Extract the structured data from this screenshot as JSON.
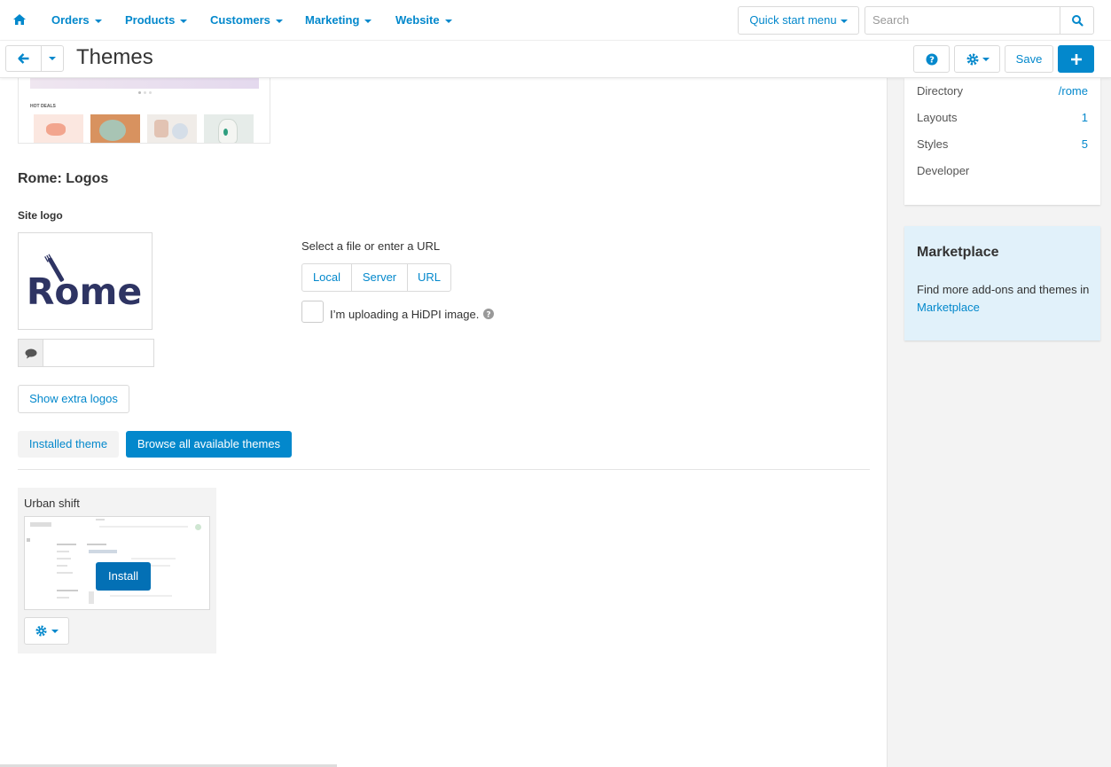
{
  "nav": {
    "items": [
      "Orders",
      "Products",
      "Customers",
      "Marketing",
      "Website"
    ],
    "quick_start": "Quick start menu",
    "search_placeholder": "Search"
  },
  "header": {
    "title": "Themes",
    "save_label": "Save"
  },
  "logos": {
    "section_title": "Rome: Logos",
    "site_logo_label": "Site logo",
    "logo_text": "Rome",
    "select_label": "Select a file or enter a URL",
    "source_options": [
      "Local",
      "Server",
      "URL"
    ],
    "hidpi_label": "I’m uploading a HiDPI image.",
    "hidpi_checked": false,
    "extra_logos_label": "Show extra logos"
  },
  "preview_top": {
    "caption": "HOT DEALS"
  },
  "tabs": {
    "installed": "Installed theme",
    "browse": "Browse all available themes"
  },
  "available_themes": [
    {
      "name": "Urban shift",
      "install_label": "Install"
    }
  ],
  "sidebar": {
    "info": [
      {
        "key": "Directory",
        "value": "/rome"
      },
      {
        "key": "Layouts",
        "value": "1"
      },
      {
        "key": "Styles",
        "value": "5"
      },
      {
        "key": "Developer",
        "value": ""
      }
    ],
    "marketplace": {
      "title": "Marketplace",
      "text": "Find more add-ons and themes in ",
      "link": "Marketplace"
    }
  },
  "colors": {
    "accent": "#0388cc",
    "logo_navy": "#2e3463",
    "marketplace_bg": "#e1f1fa"
  }
}
